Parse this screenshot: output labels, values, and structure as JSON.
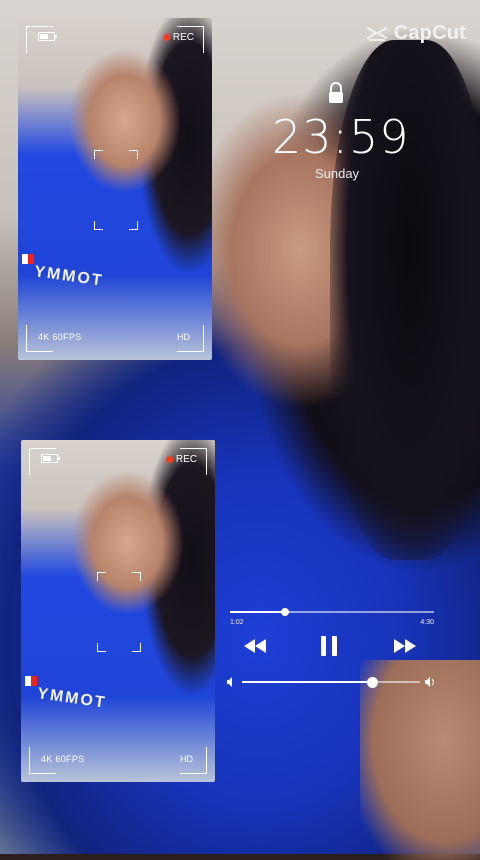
{
  "brand": {
    "name": "CapCut"
  },
  "lockscreen": {
    "time": "23:59",
    "day": "Sunday"
  },
  "camera_cards": [
    {
      "rec_label": "REC",
      "fps_label": "4K 60FPS",
      "quality_label": "HD",
      "shirt_text": "YMMOT"
    },
    {
      "rec_label": "REC",
      "fps_label": "4K 60FPS",
      "quality_label": "HD",
      "shirt_text": "YMMOT"
    }
  ],
  "player": {
    "current_time": "1:02",
    "total_time": "4:30",
    "progress_fraction": 0.27,
    "volume_fraction": 0.73
  },
  "colors": {
    "rec_dot": "#ff3b1f",
    "shirt_blue": "#1f44d6"
  }
}
